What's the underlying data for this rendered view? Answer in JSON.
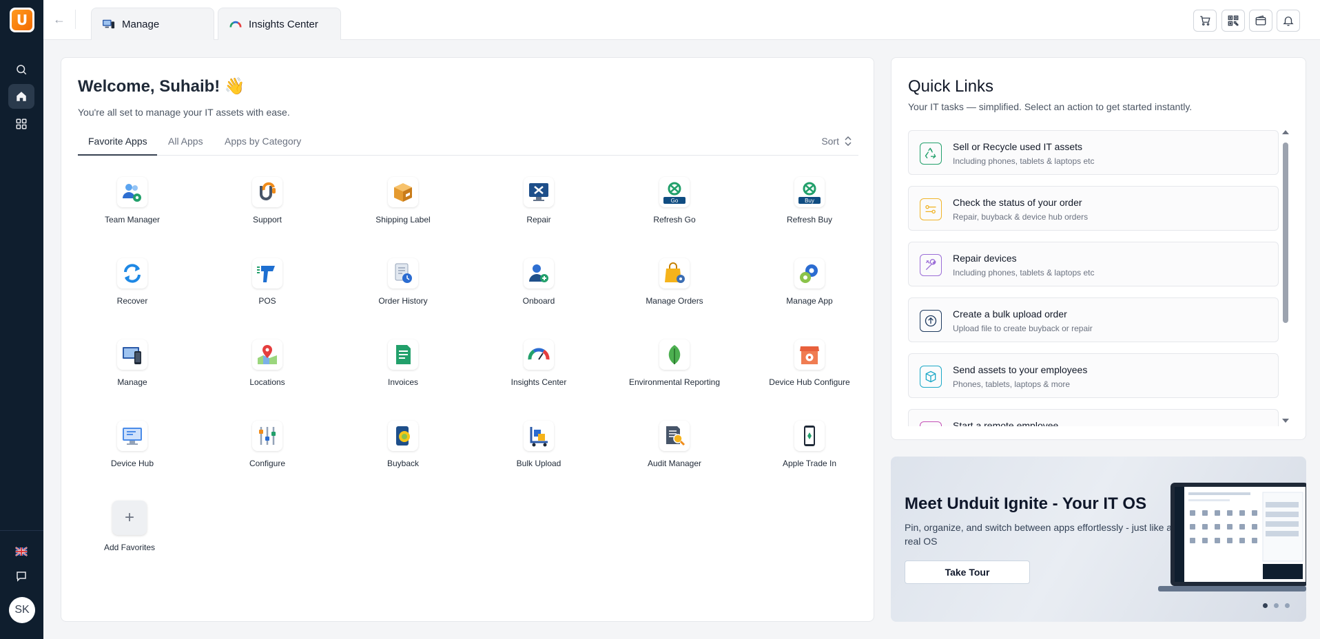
{
  "tabs": [
    {
      "label": "Manage",
      "icon": "manage-app-icon"
    },
    {
      "label": "Insights Center",
      "icon": "insights-gauge-icon"
    }
  ],
  "sidebar": {
    "avatar_initials": "SK",
    "items": [
      {
        "icon": "search-icon"
      },
      {
        "icon": "home-icon",
        "active": true
      },
      {
        "icon": "apps-grid-icon"
      }
    ],
    "bottom": [
      {
        "icon": "uk-flag-icon"
      },
      {
        "icon": "chat-icon"
      }
    ]
  },
  "topbar_icons": [
    "cart-icon",
    "qr-code-icon",
    "wallet-icon",
    "bell-icon"
  ],
  "main": {
    "welcome": "Welcome, Suhaib! 👋",
    "subtitle": "You're all set to manage your IT assets with ease.",
    "tabs": [
      {
        "label": "Favorite Apps",
        "active": true
      },
      {
        "label": "All Apps"
      },
      {
        "label": "Apps by Category"
      }
    ],
    "sort_label": "Sort",
    "apps": [
      {
        "label": "Team Manager",
        "icon": "team-manager-icon"
      },
      {
        "label": "Support",
        "icon": "support-icon"
      },
      {
        "label": "Shipping Label",
        "icon": "shipping-box-icon"
      },
      {
        "label": "Repair",
        "icon": "repair-tools-icon"
      },
      {
        "label": "Refresh Go",
        "icon": "refresh-go-icon",
        "badge": "Go"
      },
      {
        "label": "Refresh Buy",
        "icon": "refresh-buy-icon",
        "badge": "Buy"
      },
      {
        "label": "Recover",
        "icon": "recover-icon"
      },
      {
        "label": "POS",
        "icon": "pos-scanner-icon"
      },
      {
        "label": "Order History",
        "icon": "order-history-icon"
      },
      {
        "label": "Onboard",
        "icon": "onboard-user-icon"
      },
      {
        "label": "Manage Orders",
        "icon": "shopping-bag-gear-icon"
      },
      {
        "label": "Manage App",
        "icon": "gears-icon"
      },
      {
        "label": "Manage",
        "icon": "devices-icon"
      },
      {
        "label": "Locations",
        "icon": "map-pin-icon"
      },
      {
        "label": "Invoices",
        "icon": "invoice-icon"
      },
      {
        "label": "Insights Center",
        "icon": "insights-gauge-icon"
      },
      {
        "label": "Environmental Reporting",
        "icon": "leaf-icon"
      },
      {
        "label": "Device Hub Configure",
        "icon": "store-gear-icon"
      },
      {
        "label": "Device Hub",
        "icon": "monitor-icon"
      },
      {
        "label": "Configure",
        "icon": "sliders-icon"
      },
      {
        "label": "Buyback",
        "icon": "buyback-phone-icon"
      },
      {
        "label": "Bulk Upload",
        "icon": "bulk-cart-icon"
      },
      {
        "label": "Audit Manager",
        "icon": "audit-search-icon"
      },
      {
        "label": "Apple Trade In",
        "icon": "phone-trade-icon"
      }
    ],
    "add_favorites": "Add Favorites"
  },
  "quick_links": {
    "title": "Quick Links",
    "subtitle": "Your IT tasks — simplified. Select an action to get started instantly.",
    "items": [
      {
        "title": "Sell or Recycle used IT assets",
        "subtitle": "Including phones, tablets & laptops etc",
        "icon": "recycle-icon",
        "color": "#22a06b"
      },
      {
        "title": "Check the status of your order",
        "subtitle": "Repair, buyback & device hub orders",
        "icon": "status-sliders-icon",
        "color": "#f0b429"
      },
      {
        "title": "Repair devices",
        "subtitle": "Including phones, tablets & laptops etc",
        "icon": "repair-icon",
        "color": "#9b6dd7"
      },
      {
        "title": "Create a bulk upload order",
        "subtitle": "Upload file to create buyback or repair",
        "icon": "upload-icon",
        "color": "#1e3a5f"
      },
      {
        "title": "Send assets to your employees",
        "subtitle": "Phones, tablets, laptops & more",
        "icon": "box-icon",
        "color": "#1ba8c7"
      },
      {
        "title": "Start a remote employee",
        "subtitle": "",
        "icon": "employee-icon",
        "color": "#c44fb5"
      }
    ]
  },
  "promo": {
    "title": "Meet Unduit Ignite - Your IT OS",
    "description": "Pin, organize, and switch between apps effortlessly - just like a real OS",
    "button": "Take Tour",
    "slides": 3,
    "active_slide": 1
  }
}
